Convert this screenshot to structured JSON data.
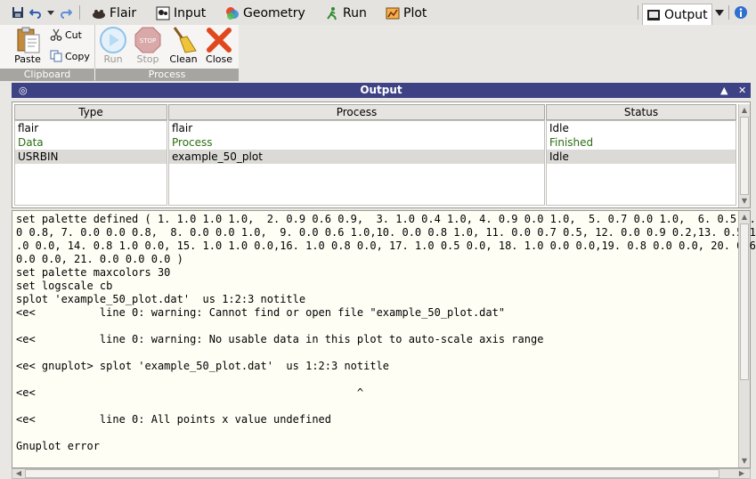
{
  "tabs": [
    {
      "name": "flair",
      "label": "Flair"
    },
    {
      "name": "input",
      "label": "Input"
    },
    {
      "name": "geometry",
      "label": "Geometry"
    },
    {
      "name": "run",
      "label": "Run"
    },
    {
      "name": "plot",
      "label": "Plot"
    }
  ],
  "active_tab": {
    "label": "Output"
  },
  "ribbon": {
    "clipboard": {
      "label": "Clipboard",
      "paste": "Paste",
      "cut": "Cut",
      "copy": "Copy"
    },
    "process": {
      "label": "Process",
      "run": "Run",
      "stop": "Stop",
      "clean": "Clean",
      "close": "Close"
    }
  },
  "panel": {
    "title": "Output"
  },
  "table": {
    "headers": [
      "Type",
      "Process",
      "Status"
    ],
    "rows": [
      {
        "type": "flair",
        "process": "flair",
        "status": "Idle"
      },
      {
        "type": "Data",
        "process": "Process",
        "status": "Finished"
      },
      {
        "type": "USRBIN",
        "process": "example_50_plot",
        "status": "Idle"
      }
    ]
  },
  "output_lines": [
    "set palette defined ( 1. 1.0 1.0 1.0,  2. 0.9 0.6 0.9,  3. 1.0 0.4 1.0, 4. 0.9 0.0 1.0,  5. 0.7 0.0 1.0,  6. 0.5 0.",
    "0 0.8, 7. 0.0 0.0 0.8,  8. 0.0 0.0 1.0,  9. 0.0 0.6 1.0,10. 0.0 0.8 1.0, 11. 0.0 0.7 0.5, 12. 0.0 0.9 0.2,13. 0.5 1",
    ".0 0.0, 14. 0.8 1.0 0.0, 15. 1.0 1.0 0.0,16. 1.0 0.8 0.0, 17. 1.0 0.5 0.0, 18. 1.0 0.0 0.0,19. 0.8 0.0 0.0, 20. 0.6",
    "0.0 0.0, 21. 0.0 0.0 0.0 )",
    "set palette maxcolors 30",
    "set logscale cb",
    "splot 'example_50_plot.dat'  us 1:2:3 notitle",
    "<e<          line 0: warning: Cannot find or open file \"example_50_plot.dat\"",
    "",
    "<e<          line 0: warning: No usable data in this plot to auto-scale axis range",
    "",
    "<e< gnuplot> splot 'example_50_plot.dat'  us 1:2:3 notitle",
    "",
    "<e<                                                  ^",
    "",
    "<e<          line 0: All points x value undefined",
    "",
    "Gnuplot error"
  ],
  "icons": {
    "save": "save-icon",
    "undo": "undo-icon",
    "dropdown": "dropdown-icon",
    "redo": "redo-icon",
    "help": "help-icon",
    "close": "close-icon",
    "maximize": "maximize-icon",
    "panel": "panel-menu-icon"
  }
}
